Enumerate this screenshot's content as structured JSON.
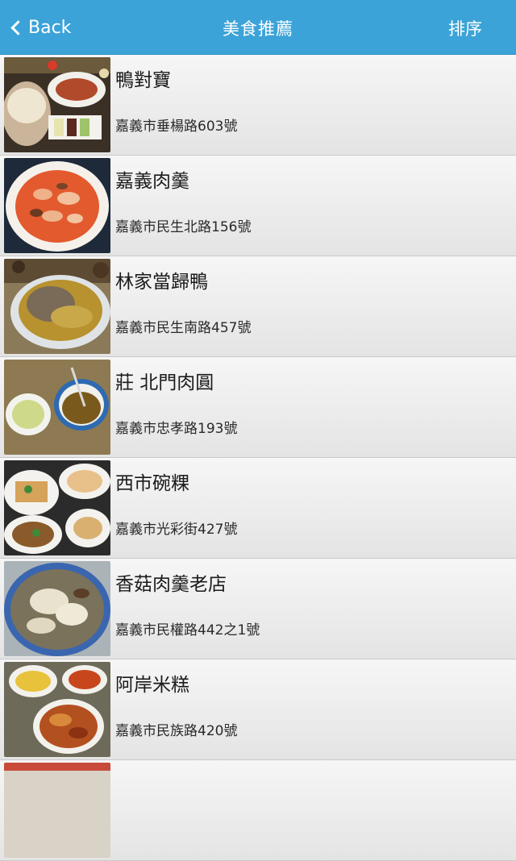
{
  "header": {
    "back_label": "Back",
    "title": "美食推薦",
    "sort_label": "排序"
  },
  "restaurants": [
    {
      "name": "鴨對寶",
      "address": "嘉義市垂楊路603號"
    },
    {
      "name": "嘉義肉羹",
      "address": "嘉義市民生北路156號"
    },
    {
      "name": "林家當歸鴨",
      "address": "嘉義市民生南路457號"
    },
    {
      "name": "莊 北門肉圓",
      "address": "嘉義市忠孝路193號"
    },
    {
      "name": "西市碗粿",
      "address": "嘉義市光彩街427號"
    },
    {
      "name": "香菇肉羹老店",
      "address": "嘉義市民權路442之1號"
    },
    {
      "name": "阿岸米糕",
      "address": "嘉義市民族路420號"
    }
  ]
}
